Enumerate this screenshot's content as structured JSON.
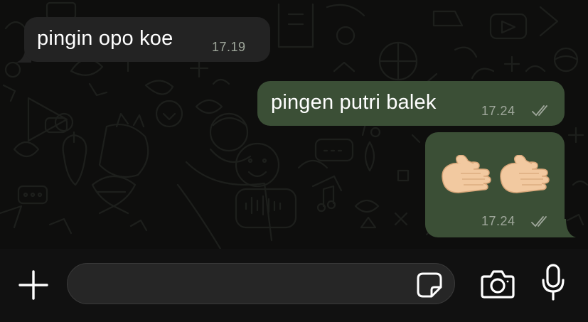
{
  "chat": {
    "messages": [
      {
        "direction": "incoming",
        "text": "pingin opo koe",
        "time": "17.19"
      },
      {
        "direction": "outgoing",
        "text": "pingen putri balek",
        "time": "17.24",
        "status": "read"
      },
      {
        "direction": "outgoing",
        "emoji": [
          "🫱",
          "🫱"
        ],
        "time": "17.24",
        "status": "read"
      }
    ]
  },
  "composer": {
    "placeholder": "",
    "value": ""
  },
  "icons": {
    "add": "plus-icon",
    "sticker": "sticker-icon",
    "camera": "camera-icon",
    "microphone": "microphone-icon",
    "read_receipt": "double-check-icon"
  },
  "colors": {
    "chat_background": "#0e0e0d",
    "incoming_bubble": "#232323",
    "outgoing_bubble": "#3b4f36",
    "timestamp": "#9fa79b",
    "input_bar": "#111111",
    "input_field": "#262626"
  }
}
